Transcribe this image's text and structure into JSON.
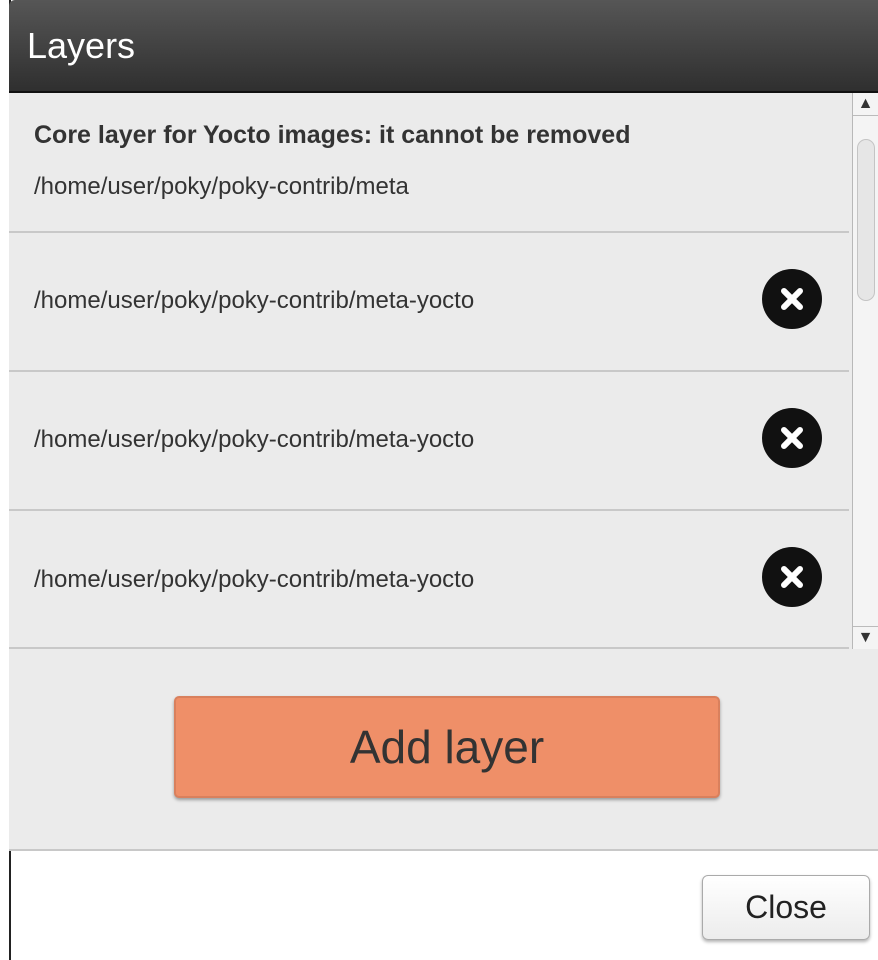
{
  "window": {
    "title": "Layers"
  },
  "layers": {
    "core": {
      "note": "Core layer for Yocto images: it cannot be removed",
      "path": "/home/user/poky/poky-contrib/meta"
    },
    "items": [
      {
        "path": "/home/user/poky/poky-contrib/meta-yocto",
        "remove_icon": "close-circle-icon"
      },
      {
        "path": "/home/user/poky/poky-contrib/meta-yocto",
        "remove_icon": "close-circle-icon"
      },
      {
        "path": "/home/user/poky/poky-contrib/meta-yocto",
        "remove_icon": "close-circle-icon"
      }
    ]
  },
  "scrollbar": {
    "up_arrow": "▲",
    "down_arrow": "▼"
  },
  "actions": {
    "add_layer_label": "Add layer",
    "close_label": "Close"
  },
  "colors": {
    "titlebar": "#3f3f3f",
    "panel_bg": "#ebebeb",
    "add_layer_bg": "#ef8f68",
    "remove_icon_bg": "#111111"
  }
}
